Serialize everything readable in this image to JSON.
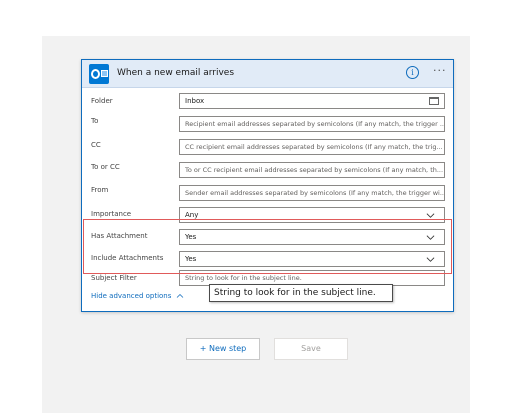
{
  "trigger_card": {
    "title": "When a new email arrives",
    "icon": "outlook-icon",
    "accent_color": "#0078d4",
    "info_glyph": "i",
    "more_glyph": "···"
  },
  "fields": [
    {
      "label": "Folder",
      "value": "Inbox",
      "is_placeholder": false,
      "control": "folder-picker"
    },
    {
      "label": "To",
      "value": "Recipient email addresses separated by semicolons (If any match, the trigger ...",
      "is_placeholder": true,
      "control": "text"
    },
    {
      "label": "CC",
      "value": "CC recipient email addresses separated by semicolons (If any match, the trig...",
      "is_placeholder": true,
      "control": "text"
    },
    {
      "label": "To or CC",
      "value": "To or CC recipient email addresses separated by semicolons (If any match, th...",
      "is_placeholder": true,
      "control": "text"
    },
    {
      "label": "From",
      "value": "Sender email addresses separated by semicolons (If any match, the trigger wi...",
      "is_placeholder": true,
      "control": "text"
    },
    {
      "label": "Importance",
      "value": "Any",
      "is_placeholder": false,
      "control": "dropdown"
    },
    {
      "label": "Has Attachment",
      "value": "Yes",
      "is_placeholder": false,
      "control": "dropdown"
    },
    {
      "label": "Include Attachments",
      "value": "Yes",
      "is_placeholder": false,
      "control": "dropdown"
    },
    {
      "label": "Subject Filter",
      "value": "String to look for in the subject line.",
      "is_placeholder": true,
      "control": "text"
    }
  ],
  "hide_advanced_label": "Hide advanced options",
  "tooltip_text": "String to look for in the subject line.",
  "new_step_label": "+ New step",
  "save_label": "Save"
}
